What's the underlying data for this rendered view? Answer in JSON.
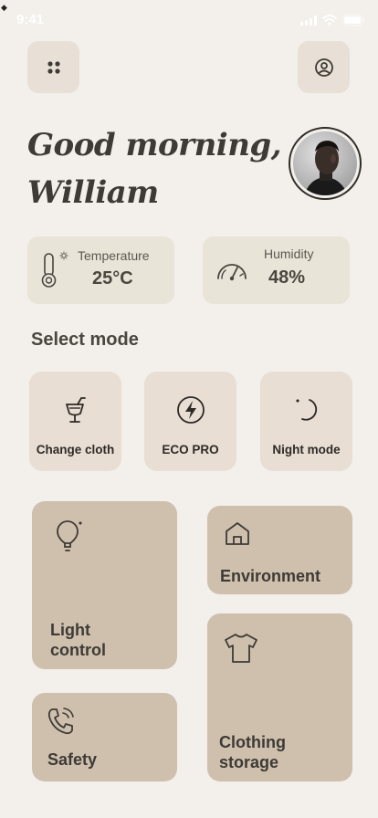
{
  "status": {
    "time": "9:41"
  },
  "greeting": {
    "line1": "Good morning,",
    "line2": "William"
  },
  "stats": [
    {
      "label": "Temperature",
      "value": "25°C",
      "icon": "thermometer-icon"
    },
    {
      "label": "Humidity",
      "value": "48%",
      "icon": "gauge-icon"
    }
  ],
  "modes": {
    "title": "Select mode",
    "items": [
      {
        "label": "Change cloth",
        "icon": "cocktail-glass-icon"
      },
      {
        "label": "ECO PRO",
        "icon": "lightning-icon"
      },
      {
        "label": "Night mode",
        "icon": "moon-icon"
      }
    ]
  },
  "tiles": {
    "light": {
      "line1": "Light",
      "line2": "control",
      "icon": "lightbulb-icon"
    },
    "environment": {
      "label": "Environment",
      "icon": "home-icon"
    },
    "safety": {
      "label": "Safety",
      "icon": "phone-icon"
    },
    "storage": {
      "line1": "Clothing",
      "line2": "storage",
      "icon": "tshirt-icon"
    }
  },
  "colors": {
    "background": "#F3EFEA",
    "card": "#E8E0D7",
    "tile": "#CFC0AE",
    "text": "#3E3A35"
  }
}
